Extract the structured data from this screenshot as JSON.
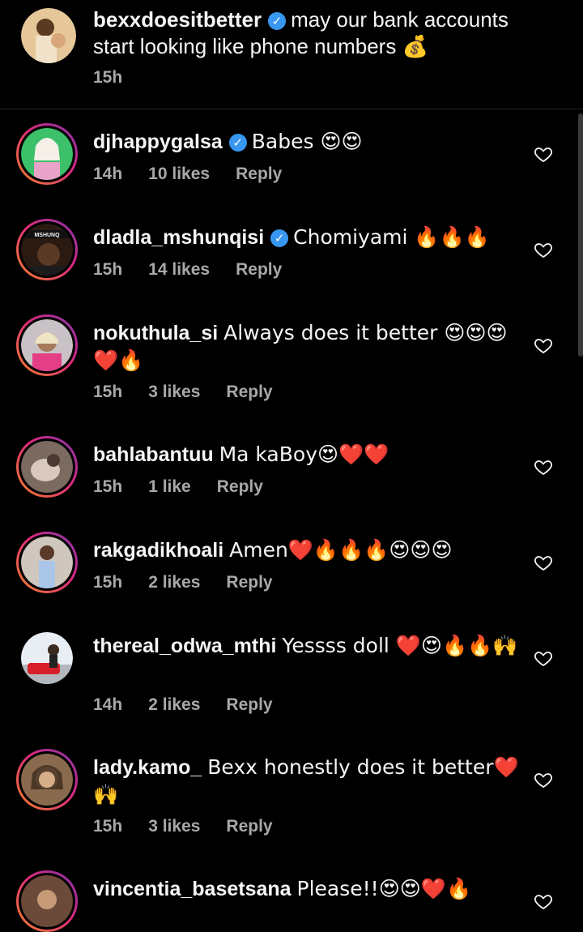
{
  "caption": {
    "username": "bexxdoesitbetter",
    "verified": true,
    "text": "may our bank accounts start looking like phone numbers 💰",
    "time": "15h"
  },
  "comments": [
    {
      "username": "djhappygalsa",
      "verified": true,
      "text": "Babes 😍😍",
      "time": "14h",
      "likes": "10 likes",
      "reply": "Reply"
    },
    {
      "username": "dladla_mshunqisi",
      "verified": true,
      "text": "Chomiyami 🔥🔥🔥",
      "time": "15h",
      "likes": "14 likes",
      "reply": "Reply",
      "avatar_label": "MSHUNQ"
    },
    {
      "username": "nokuthula_si",
      "verified": false,
      "text": "Always does it better 😍😍😍❤️🔥",
      "time": "15h",
      "likes": "3 likes",
      "reply": "Reply"
    },
    {
      "username": "bahlabantuu",
      "verified": false,
      "text": "Ma kaBoy😍❤️❤️",
      "time": "15h",
      "likes": "1 like",
      "reply": "Reply"
    },
    {
      "username": "rakgadikhoali",
      "verified": false,
      "text": "Amen❤️🔥🔥🔥😍😍😍",
      "time": "15h",
      "likes": "2 likes",
      "reply": "Reply"
    },
    {
      "username": "thereal_odwa_mthi",
      "verified": false,
      "text": "Yessss doll ❤️😍🔥🔥🙌",
      "time": "14h",
      "likes": "2 likes",
      "reply": "Reply"
    },
    {
      "username": "lady.kamo_",
      "verified": false,
      "text": "Bexx honestly does it better❤️🙌",
      "time": "15h",
      "likes": "3 likes",
      "reply": "Reply"
    },
    {
      "username": "vincentia_basetsana",
      "verified": false,
      "text": "Please!!😍😍❤️🔥",
      "time": "",
      "likes": "",
      "reply": ""
    }
  ],
  "icons": {
    "heart": "heart-outline-icon",
    "verified": "verified-badge-icon"
  },
  "colors": {
    "background": "#000000",
    "text": "#f5f5f5",
    "meta": "#a8a8a8",
    "verified": "#3897f0"
  }
}
